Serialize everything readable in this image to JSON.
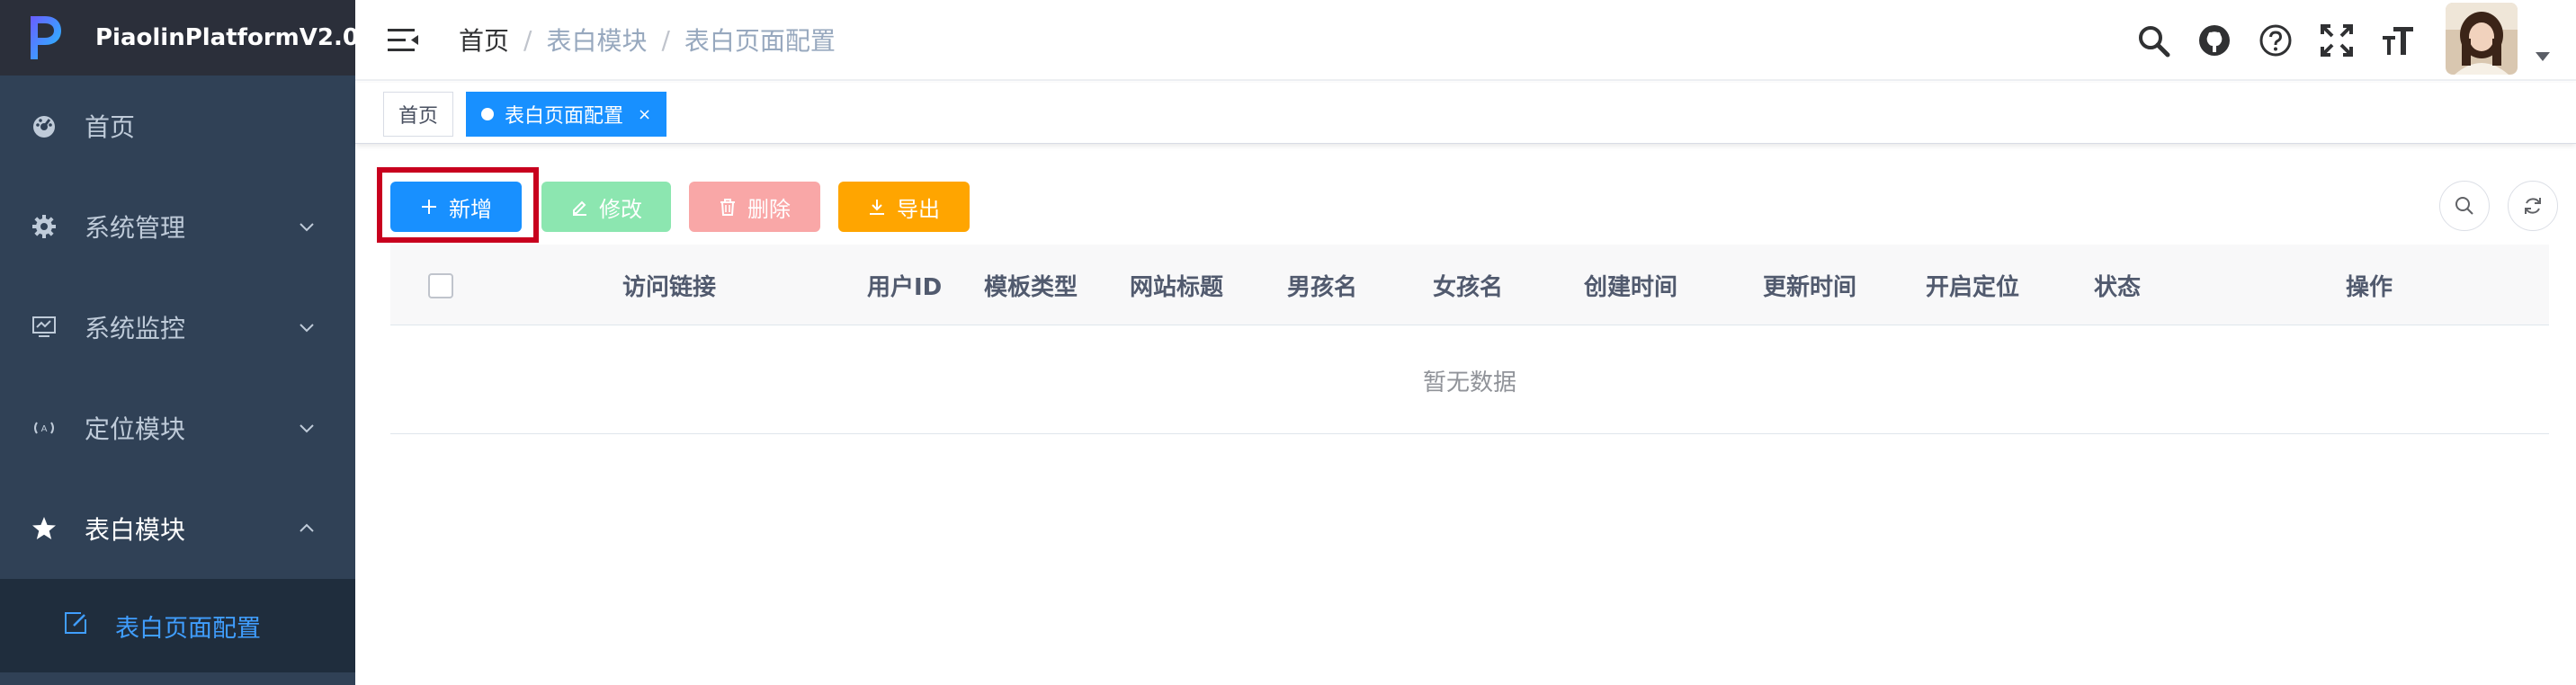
{
  "app": {
    "title": "PiaolinPlatformV2.0",
    "colors": {
      "sidebar": "#304156",
      "accent": "#1890ff",
      "active_menu": "#409eff"
    }
  },
  "sidebar": {
    "items": [
      {
        "label": "首页",
        "icon": "dashboard-icon"
      },
      {
        "label": "系统管理",
        "icon": "gear-icon"
      },
      {
        "label": "系统监控",
        "icon": "monitor-icon"
      },
      {
        "label": "定位模块",
        "icon": "location-icon"
      },
      {
        "label": "表白模块",
        "icon": "star-icon"
      }
    ],
    "submenu": {
      "label": "表白页面配置",
      "icon": "edit-icon"
    }
  },
  "header": {
    "breadcrumb": [
      "首页",
      "表白模块",
      "表白页面配置"
    ],
    "tools": [
      "search-icon",
      "github-icon",
      "question-icon",
      "fullscreen-icon",
      "font-size-icon"
    ]
  },
  "tags": [
    {
      "label": "首页"
    },
    {
      "label": "表白页面配置",
      "close": "×"
    }
  ],
  "toolbar": {
    "add": "新增",
    "edit": "修改",
    "delete": "删除",
    "export": "导出"
  },
  "table": {
    "columns": [
      "访问链接",
      "用户ID",
      "模板类型",
      "网站标题",
      "男孩名",
      "女孩名",
      "创建时间",
      "更新时间",
      "开启定位",
      "状态",
      "操作"
    ],
    "empty_text": "暂无数据"
  }
}
